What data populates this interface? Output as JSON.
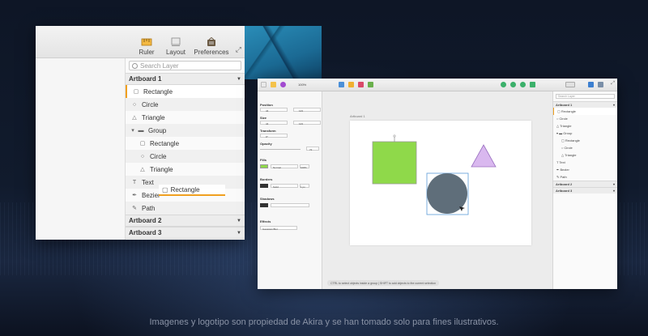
{
  "left_window": {
    "toolbar": {
      "ruler": "Ruler",
      "layout": "Layout",
      "preferences": "Preferences"
    },
    "search_placeholder": "Search Layer",
    "artboards": [
      {
        "label": "Artboard 1"
      },
      {
        "label": "Artboard 2"
      },
      {
        "label": "Artboard 3"
      }
    ],
    "layers": [
      {
        "label": "Rectangle",
        "icon": "rect"
      },
      {
        "label": "Circle",
        "icon": "circle"
      },
      {
        "label": "Triangle",
        "icon": "triangle"
      },
      {
        "label": "Group",
        "icon": "folder"
      },
      {
        "label": "Rectangle",
        "icon": "rect"
      },
      {
        "label": "Circle",
        "icon": "circle"
      },
      {
        "label": "Triangle",
        "icon": "triangle"
      },
      {
        "label": "Text",
        "icon": "text"
      },
      {
        "label": "Bezier",
        "icon": "pen"
      },
      {
        "label": "Path",
        "icon": "pencil"
      }
    ],
    "drag_label": "Rectangle"
  },
  "right_window": {
    "zoom": "100%",
    "search_placeholder": "Search Layer",
    "artboard_label": "Artboard 1",
    "props": {
      "position": "Position",
      "size": "Size",
      "transform": "Transform",
      "opacity": "Opacity",
      "opacity_value": "72",
      "fills": "Fills",
      "fill_mode": "Normal",
      "fill_value": "100%",
      "borders": "Borders",
      "border_mode": "Solid",
      "border_value": "1 px",
      "shadows": "Shadows",
      "effects": "Effects",
      "effect_mode": "Gaussian Blur",
      "x": "44",
      "y": "123",
      "w": "44",
      "h": "123",
      "rot": "0°",
      "hide": "1"
    },
    "layers": [
      {
        "label": "Artboard 1",
        "kind": "ab"
      },
      {
        "label": "Rectangle",
        "kind": "row",
        "sel": true
      },
      {
        "label": "Circle",
        "kind": "row"
      },
      {
        "label": "Triangle",
        "kind": "row"
      },
      {
        "label": "Group",
        "kind": "row"
      },
      {
        "label": "Rectangle",
        "kind": "in"
      },
      {
        "label": "Circle",
        "kind": "in"
      },
      {
        "label": "Triangle",
        "kind": "in"
      },
      {
        "label": "Text",
        "kind": "row"
      },
      {
        "label": "Bezier",
        "kind": "row"
      },
      {
        "label": "Path",
        "kind": "row"
      },
      {
        "label": "Artboard 2",
        "kind": "ab"
      },
      {
        "label": "Artboard 3",
        "kind": "ab"
      }
    ],
    "status": "CTRL to select objects inside a group | SHIFT to add objects to the current selection"
  },
  "caption": "Imagenes y logotipo son propiedad de Akira y se han tomado solo para fines ilustrativos.",
  "colors": {
    "accent": "#f0a020",
    "rect_fill": "#8fd94a",
    "circle_fill": "#5f6e7a",
    "triangle_fill": "#d9b8ef"
  }
}
